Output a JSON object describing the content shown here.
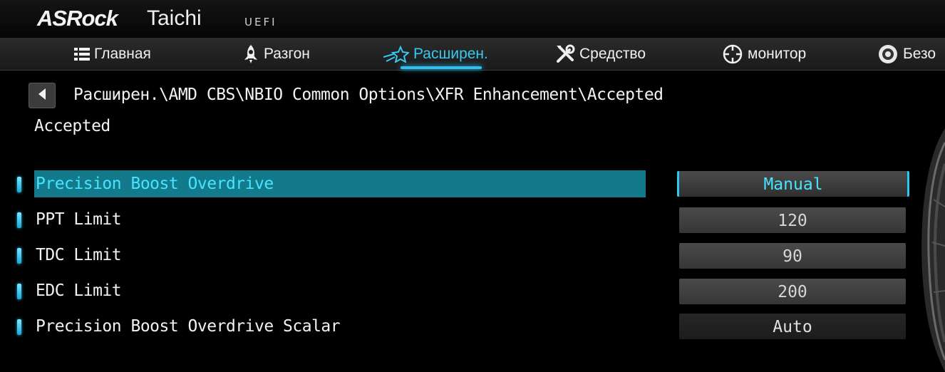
{
  "header": {
    "brand": "ASRock",
    "model": "Taichi",
    "uefi": "UEFI"
  },
  "nav": {
    "tabs": [
      {
        "label": "Главная",
        "icon": "list-icon"
      },
      {
        "label": "Разгон",
        "icon": "rocket-icon"
      },
      {
        "label": "Расширен.",
        "icon": "star-icon",
        "active": true
      },
      {
        "label": "Средство",
        "icon": "tools-icon"
      },
      {
        "label": "монитор",
        "icon": "crosshair-icon"
      },
      {
        "label": "Безо",
        "icon": "shield-icon"
      }
    ]
  },
  "breadcrumb": {
    "path": "Расширен.\\AMD CBS\\NBIO Common Options\\XFR Enhancement\\Accepted",
    "subtitle": "Accepted"
  },
  "settings": [
    {
      "label": "Precision Boost Overdrive",
      "value": "Manual",
      "selected": true
    },
    {
      "label": "PPT Limit",
      "value": "120"
    },
    {
      "label": "TDC Limit",
      "value": "90"
    },
    {
      "label": "EDC Limit",
      "value": "200"
    },
    {
      "label": "Precision Boost Overdrive Scalar",
      "value": "Auto"
    }
  ],
  "colors": {
    "accent": "#2cc1f0",
    "selected_row": "#137a8c",
    "selected_text": "#48e4ff"
  }
}
